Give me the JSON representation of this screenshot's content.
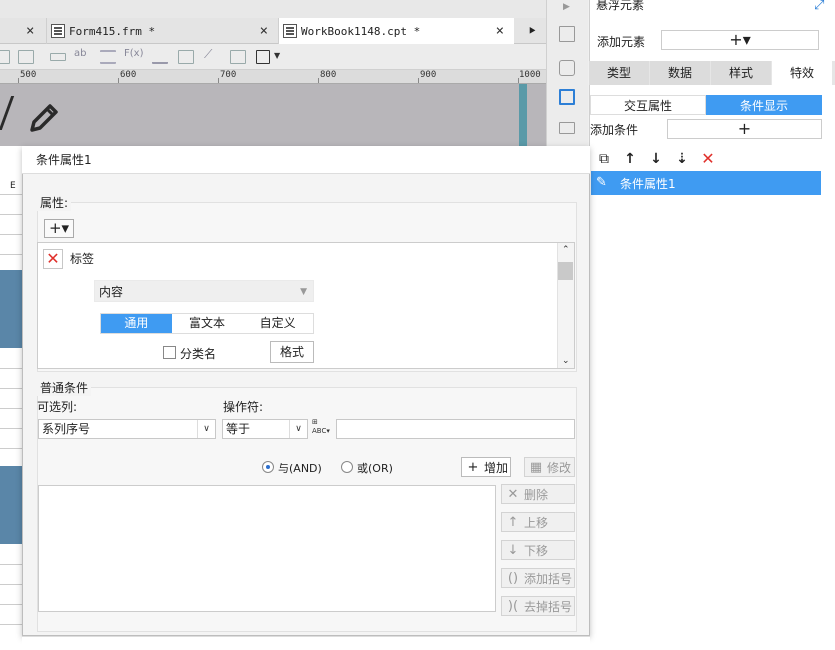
{
  "tabs": [
    {
      "label": "",
      "close": "×"
    },
    {
      "label": "Form415.frm *",
      "close": "×"
    },
    {
      "label": "WorkBook1148.cpt *",
      "close": "×"
    }
  ],
  "ruler": {
    "marks": [
      "500",
      "600",
      "700",
      "800",
      "900",
      "1000"
    ]
  },
  "grid": {
    "column_letter": "E"
  },
  "right_panel": {
    "title": "悬浮元素",
    "add_element_label": "添加元素",
    "add_element_button": "+▾",
    "tabs": [
      {
        "label": "类型",
        "active": false
      },
      {
        "label": "数据",
        "active": false
      },
      {
        "label": "样式",
        "active": false
      },
      {
        "label": "特效",
        "active": true
      }
    ],
    "subtabs": [
      {
        "label": "交互属性",
        "active": false
      },
      {
        "label": "条件显示",
        "active": true
      }
    ],
    "add_condition_label": "添加条件",
    "add_condition_button": "+",
    "condition_items": [
      {
        "label": "条件属性1"
      }
    ]
  },
  "dialog": {
    "title": "条件属性1",
    "properties": {
      "legend": "属性:",
      "add_button": "+▾",
      "tag_label": "标签",
      "content_select": "内容",
      "segments": [
        {
          "label": "通用",
          "active": true
        },
        {
          "label": "富文本",
          "active": false
        },
        {
          "label": "自定义",
          "active": false
        }
      ],
      "category_checkbox_label": "分类名",
      "format_button": "格式"
    },
    "normal_condition": {
      "legend": "普通条件",
      "column_label": "可选列:",
      "column_value": "系列序号",
      "operator_label": "操作符:",
      "operator_value": "等于",
      "value_input": "",
      "radio_and": "与(AND)",
      "radio_or": "或(OR)",
      "add_button": "增加",
      "modify_button": "修改"
    },
    "list_buttons": {
      "delete": "删除",
      "move_up": "上移",
      "move_down": "下移",
      "add_bracket": "添加括号",
      "remove_bracket": "去掉括号"
    }
  },
  "colors": {
    "accent": "#3f9bf2",
    "danger": "#e0302b",
    "canvas_bar": "#5a86a8"
  }
}
